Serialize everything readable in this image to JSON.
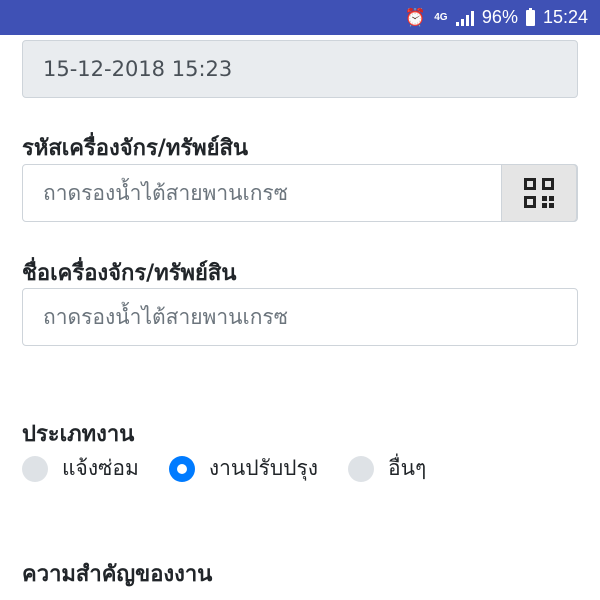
{
  "status_bar": {
    "network": "4G",
    "battery": "96%",
    "time": "15:24"
  },
  "form": {
    "datetime_value": "15-12-2018 15:23",
    "asset_code": {
      "label": "รหัสเครื่องจักร/ทรัพย์สิน",
      "value": "ถาดรองน้ำไต้สายพานเกรซ"
    },
    "asset_name": {
      "label": "ชื่อเครื่องจักร/ทรัพย์สิน",
      "value": "ถาดรองน้ำไต้สายพานเกรซ"
    },
    "job_type": {
      "label": "ประเภทงาน",
      "options": [
        "แจ้งซ่อม",
        "งานปรับปรุง",
        "อื่นๆ"
      ],
      "selected": "งานปรับปรุง"
    },
    "priority": {
      "label": "ความสำคัญของงาน"
    }
  },
  "colors": {
    "status_bar": "#3f51b5",
    "radio_selected": "#007bff",
    "radio_unselected": "#dee2e6"
  }
}
